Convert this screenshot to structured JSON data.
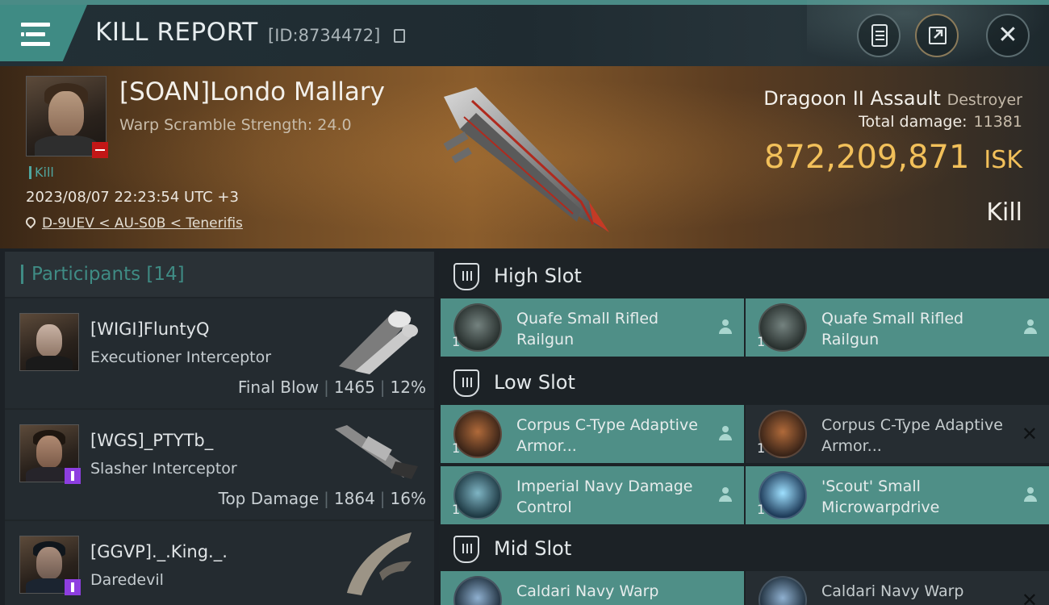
{
  "header": {
    "title": "KILL REPORT",
    "report_id": "[ID:8734472]",
    "icons": [
      "menu-icon",
      "copy-icon",
      "clipboard-icon",
      "share-icon",
      "close-icon"
    ],
    "close_glyph": "✕"
  },
  "victim": {
    "name": "[SOAN]Londo Mallary",
    "warp_scramble": "Warp Scramble Strength: 24.0",
    "kill_tag": "Kill",
    "timestamp": "2023/08/07 22:23:54 UTC +3",
    "location": "D-9UEV < AU-S0B < Tenerifis",
    "ship_name": "Dragoon II Assault",
    "ship_class": "Destroyer",
    "total_damage_label": "Total damage:",
    "total_damage_value": "11381",
    "isk_amount": "872,209,871",
    "isk_unit": "ISK",
    "result": "Kill"
  },
  "participants": {
    "title": "Participants",
    "count": "[14]",
    "rows": [
      {
        "name": "[WIGI]FluntyQ",
        "ship": "Executioner Interceptor",
        "role": "Final Blow",
        "damage": "1465",
        "percent": "12%"
      },
      {
        "name": "[WGS]_PTYTb_",
        "ship": "Slasher Interceptor",
        "role": "Top Damage",
        "damage": "1864",
        "percent": "16%"
      },
      {
        "name": "[GGVP]._.King._.",
        "ship": "Daredevil"
      }
    ]
  },
  "fitting": {
    "high_slot": {
      "title": "High Slot",
      "modules": [
        {
          "name": "Quafe Small Rifled Railgun",
          "qty": "1",
          "state": "dropped"
        },
        {
          "name": "Quafe Small Rifled Railgun",
          "qty": "1",
          "state": "dropped"
        }
      ]
    },
    "low_slot": {
      "title": "Low Slot",
      "modules": [
        {
          "name": "Corpus C-Type Adaptive Armor...",
          "qty": "1",
          "state": "dropped"
        },
        {
          "name": "Corpus C-Type Adaptive Armor...",
          "qty": "1",
          "state": "destroyed"
        },
        {
          "name": "Imperial Navy Damage Control",
          "qty": "1",
          "state": "dropped"
        },
        {
          "name": "'Scout' Small Microwarpdrive",
          "qty": "1",
          "state": "dropped"
        }
      ]
    },
    "mid_slot": {
      "title": "Mid Slot",
      "modules": [
        {
          "name": "Caldari Navy Warp",
          "qty": "1",
          "state": "dropped"
        },
        {
          "name": "Caldari Navy Warp",
          "qty": "1",
          "state": "destroyed"
        }
      ]
    },
    "destroyed_glyph": "✕"
  },
  "colors": {
    "accent_teal": "#3f8b84",
    "isk_gold": "#f2c05a",
    "security_red": "#c21717",
    "corp_purple": "#8d3ee0"
  }
}
